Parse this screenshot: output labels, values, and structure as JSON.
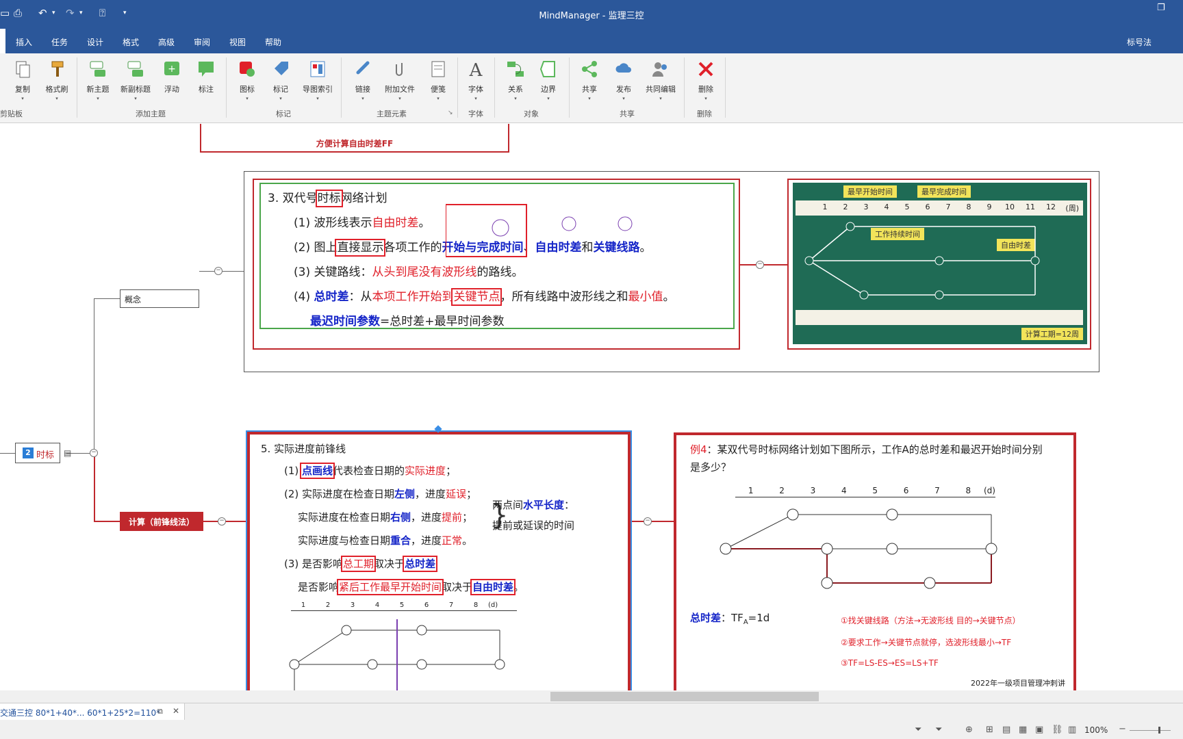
{
  "window": {
    "title": "MindManager - 监理三控"
  },
  "menu": {
    "tabs": [
      "插入",
      "任务",
      "设计",
      "格式",
      "高级",
      "审阅",
      "视图",
      "帮助"
    ],
    "right_label": "标号法"
  },
  "ribbon": {
    "buttons": [
      "复制",
      "格式刷",
      "新主题",
      "新副标题",
      "浮动",
      "标注",
      "图标",
      "标记",
      "导图索引",
      "链接",
      "附加文件",
      "便笺",
      "字体",
      "关系",
      "边界",
      "共享",
      "发布",
      "共同编辑",
      "删除"
    ],
    "groups": [
      "剪贴板",
      "添加主题",
      "标记",
      "主题元素",
      "字体",
      "对象",
      "共享",
      "删除"
    ]
  },
  "canvas": {
    "top_note": "方便计算自由时差FF",
    "concept_label": "概念",
    "time_node_num": "2",
    "time_node_label": "时标",
    "calc_label": "计算（前锋线法）",
    "slide3": {
      "title_a": "3. 双代号",
      "title_b": "时标",
      "title_c": "网络计划",
      "l1a": "(1) 波形线表示",
      "l1b": "自由时差",
      "l1c": "。",
      "l2a": "(2) 图上",
      "l2b": "直接显示",
      "l2c": "各项工作的",
      "l2d": "开始与完成时间",
      "l2e": "、",
      "l2f": "自由时差",
      "l2g": "和",
      "l2h": "关键线路",
      "l2i": "。",
      "l3a": "(3) 关键路线：",
      "l3b": "从头到尾没有波形线",
      "l3c": "的路线。",
      "l4a": "(4) ",
      "l4b": "总时差",
      "l4c": "：从",
      "l4d": "本项工作开始到",
      "l4e": "关键节点",
      "l4f": "，所有线路中波形线之和",
      "l4g": "最小值",
      "l4h": "。",
      "l5a": "最迟时间参数",
      "l5b": "=总时差+最早时间参数"
    },
    "photo": {
      "label1": "最早开始时间",
      "label2": "最早完成时间",
      "label3": "工作持续时间",
      "label4": "自由时差",
      "footer": "计算工期=12周",
      "unit": "(周)",
      "ticks": [
        "1",
        "2",
        "3",
        "4",
        "5",
        "6",
        "7",
        "8",
        "9",
        "10",
        "11",
        "12"
      ]
    },
    "slide5": {
      "title": "5. 实际进度前锋线",
      "l1a": "(1) ",
      "l1b": "点画线",
      "l1c": "代表检查日期的",
      "l1d": "实际进度",
      "l1e": "；",
      "l2a": "(2) 实际进度在检查日期",
      "l2b": "左侧",
      "l2c": "，进度",
      "l2d": "延误",
      "l2e": "；",
      "l3a": "实际进度在检查日期",
      "l3b": "右侧",
      "l3c": "，进度",
      "l3d": "提前",
      "l3e": "；",
      "l4a": "实际进度与检查日期",
      "l4b": "重合",
      "l4c": "，进度",
      "l4d": "正常",
      "l4e": "。",
      "side1a": "两点间",
      "side1b": "水平长度",
      "side1c": "：",
      "side2": "提前或延误的时间",
      "l5a": "(3) 是否影响",
      "l5b": "总工期",
      "l5c": "取决于",
      "l5d": "总时差",
      "l6a": "是否影响",
      "l6b": "紧后工作最早开始时间",
      "l6c": "取决于",
      "l6d": "自由时差",
      "l6e": "。",
      "unit": "(d)",
      "ticks": [
        "1",
        "2",
        "3",
        "4",
        "5",
        "6",
        "7",
        "8"
      ]
    },
    "example": {
      "l1a": "例4",
      "l1b": "：某双代号时标网络计划如下图所示，工作A的总时差和最迟开始时间分别",
      "l2": "是多少？",
      "unit": "(d)",
      "ticks": [
        "1",
        "2",
        "3",
        "4",
        "5",
        "6",
        "7",
        "8"
      ],
      "tf_label": "总时差",
      "tf_value": "：TF",
      "tf_sub": "A",
      "tf_eq": "=1d",
      "note1": "①找关键线路（方法→无波形线 目的→关键节点）",
      "note2": "②要求工作→关键节点就停，选波形线最小→TF",
      "note3": "③TF=LS-ES→ES=LS+TF",
      "footer": "2022年一级项目管理冲刺讲"
    }
  },
  "status": {
    "doc_tab": "交通三控 80*1+40*... 60*1+25*2=110*",
    "zoom": "100%"
  }
}
